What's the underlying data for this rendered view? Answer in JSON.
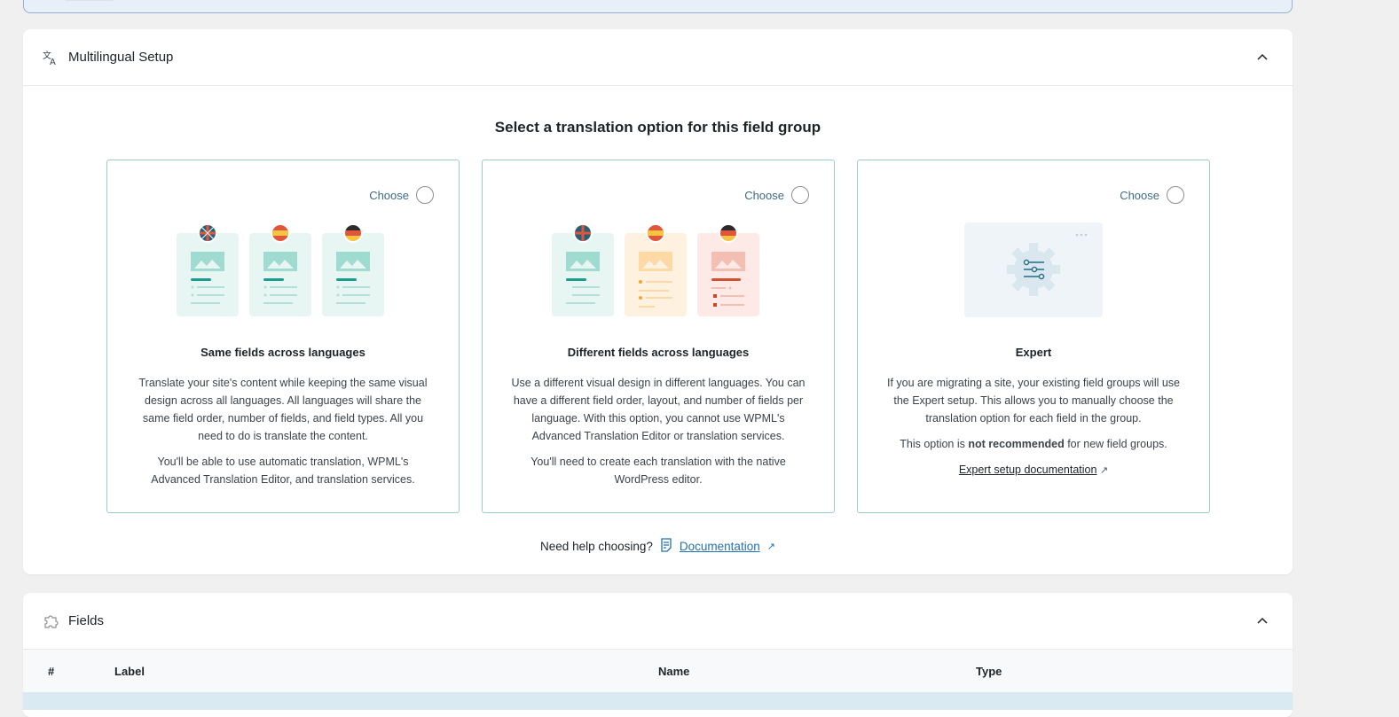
{
  "multilingual": {
    "header": "Multilingual Setup",
    "title": "Select a translation option for this field group",
    "choose_label": "Choose",
    "cards": [
      {
        "title": "Same fields across languages",
        "paragraphs": [
          "Translate your site's content while keeping the same visual design across all languages. All languages will share the same field order, number of fields, and field types. All you need to do is translate the content.",
          "You'll be able to use automatic translation, WPML's Advanced Translation Editor, and translation services."
        ]
      },
      {
        "title": "Different fields across languages",
        "paragraphs": [
          "Use a different visual design in different languages. You can have a different field order, layout, and number of fields per language. With this option, you cannot use WPML's Advanced Translation Editor or translation services.",
          "You'll need to create each translation with the native WordPress editor."
        ]
      },
      {
        "title": "Expert",
        "paragraphs": [
          "If you are migrating a site, your existing field groups will use the Expert setup. This allows you to manually choose the translation option for each field in the group."
        ],
        "note_prefix": "This option is ",
        "note_bold": "not recommended",
        "note_suffix": " for new field groups.",
        "link": "Expert setup documentation"
      }
    ],
    "help_text": "Need help choosing?",
    "help_link": "Documentation"
  },
  "fields": {
    "header": "Fields",
    "columns": [
      "#",
      "Label",
      "Name",
      "Type"
    ]
  },
  "colors": {
    "accent": "#2271b1",
    "card_border": "#9ccdc6",
    "teal": "#1a9e8f"
  }
}
